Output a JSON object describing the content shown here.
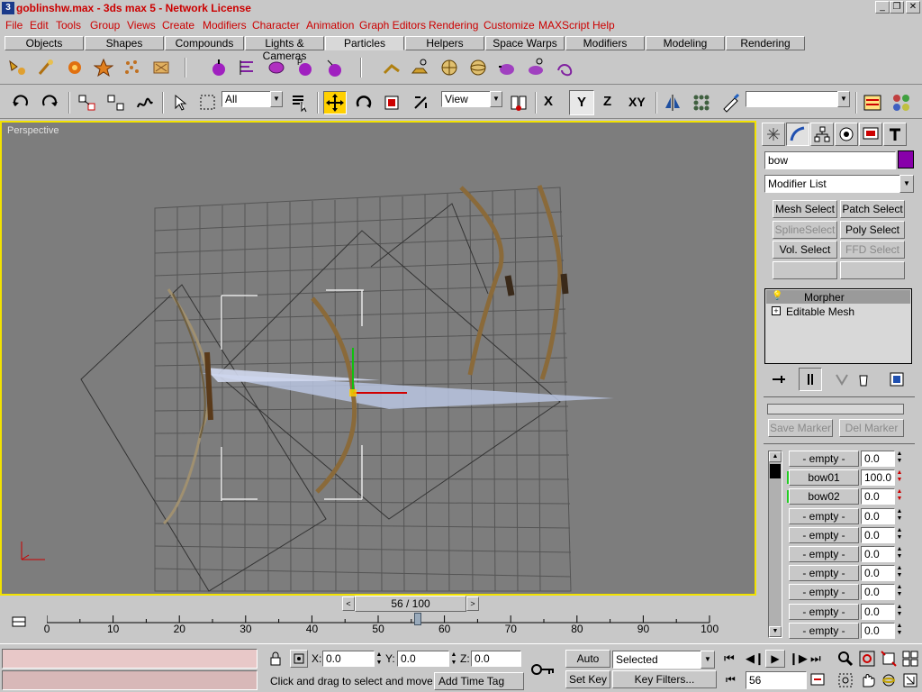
{
  "window": {
    "title": "goblinshw.max - 3ds max 5 - Network License"
  },
  "menu": [
    "File",
    "Edit",
    "Tools",
    "Group",
    "Views",
    "Create",
    "Modifiers",
    "Character",
    "Animation",
    "Graph Editors",
    "Rendering",
    "Customize",
    "MAXScript",
    "Help"
  ],
  "tabs": [
    "Objects",
    "Shapes",
    "Compounds",
    "Lights & Cameras",
    "Particles",
    "Helpers",
    "Space Warps",
    "Modifiers",
    "Modeling",
    "Rendering"
  ],
  "active_tab": "Particles",
  "toolbar": {
    "selection_filter": "All",
    "ref_coord": "View",
    "axis_x": "X",
    "axis_y": "Y",
    "axis_z": "Z",
    "axis_xy": "XY",
    "named_selection": ""
  },
  "viewport": {
    "label": "Perspective"
  },
  "panel": {
    "object_name": "bow",
    "object_color": "#8800aa",
    "modifier_list": "Modifier List",
    "buttons": [
      {
        "label": "Mesh Select",
        "enabled": true
      },
      {
        "label": "Patch Select",
        "enabled": true
      },
      {
        "label": "SplineSelect",
        "enabled": false
      },
      {
        "label": "Poly Select",
        "enabled": true
      },
      {
        "label": "Vol. Select",
        "enabled": true
      },
      {
        "label": "FFD Select",
        "enabled": false
      }
    ],
    "stack": [
      {
        "label": "Morpher",
        "selected": true
      },
      {
        "label": "Editable Mesh",
        "selected": false
      }
    ],
    "save_marker": "Save Marker",
    "del_marker": "Del Marker",
    "channels": [
      {
        "name": "- empty -",
        "value": "0.0",
        "active": false
      },
      {
        "name": "bow01",
        "value": "100.0",
        "active": true
      },
      {
        "name": "bow02",
        "value": "0.0",
        "active": true
      },
      {
        "name": "- empty -",
        "value": "0.0",
        "active": false
      },
      {
        "name": "- empty -",
        "value": "0.0",
        "active": false
      },
      {
        "name": "- empty -",
        "value": "0.0",
        "active": false
      },
      {
        "name": "- empty -",
        "value": "0.0",
        "active": false
      },
      {
        "name": "- empty -",
        "value": "0.0",
        "active": false
      },
      {
        "name": "- empty -",
        "value": "0.0",
        "active": false
      },
      {
        "name": "- empty -",
        "value": "0.0",
        "active": false
      }
    ]
  },
  "timeline": {
    "frame_display": "56 / 100",
    "ticks": [
      "0",
      "10",
      "20",
      "30",
      "40",
      "50",
      "60",
      "70",
      "80",
      "90",
      "100"
    ],
    "current_frame": 56
  },
  "status": {
    "x_label": "X:",
    "x": "0.0",
    "y_label": "Y:",
    "y": "0.0",
    "z_label": "Z:",
    "z": "0.0",
    "prompt": "Click and drag to select and move obj",
    "add_time_tag": "Add Time Tag",
    "auto_key": "Auto Key",
    "set_key": "Set Key",
    "key_mode": "Selected",
    "key_filters": "Key Filters...",
    "frame": "56"
  },
  "colors": {
    "viewport_border": "#f2e200",
    "menu_text": "#cc0000",
    "viewport_bg": "#7d7d7d"
  }
}
